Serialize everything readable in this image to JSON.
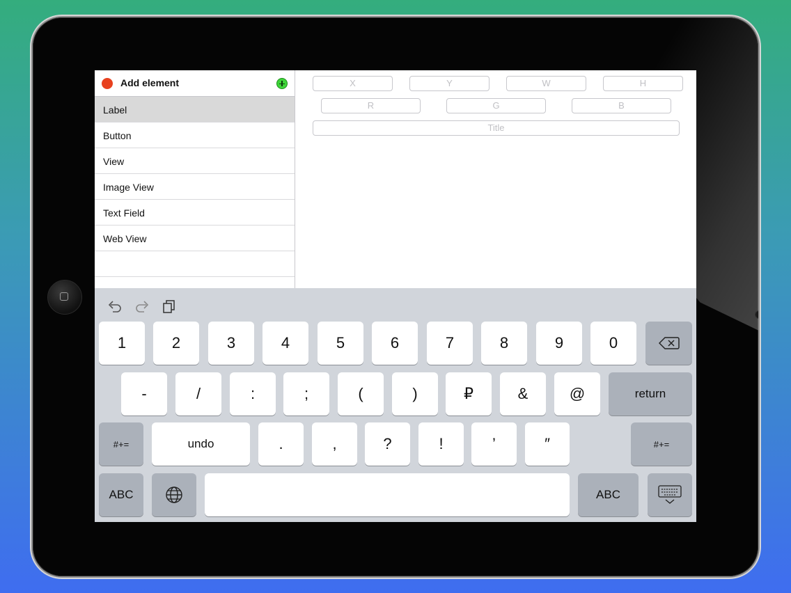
{
  "sidebar": {
    "title": "Add element",
    "items": [
      {
        "label": "Label"
      },
      {
        "label": "Button"
      },
      {
        "label": "View"
      },
      {
        "label": "Image View"
      },
      {
        "label": "Text Field"
      },
      {
        "label": "Web View"
      }
    ],
    "selected_index": 0
  },
  "inspector": {
    "placeholders": {
      "x": "X",
      "y": "Y",
      "w": "W",
      "h": "H",
      "r": "R",
      "g": "G",
      "b": "B",
      "title": "Title"
    }
  },
  "keyboard": {
    "row1": [
      "1",
      "2",
      "3",
      "4",
      "5",
      "6",
      "7",
      "8",
      "9",
      "0"
    ],
    "row2": [
      "-",
      "/",
      ":",
      ";",
      "(",
      ")",
      "₽",
      "&",
      "@"
    ],
    "return_label": "return",
    "row3_left": "#+=",
    "undo_label": "undo",
    "row3": [
      ".",
      ",",
      "?",
      "!",
      "’",
      "″"
    ],
    "row3_right": "#+=",
    "abc_left": "ABC",
    "abc_right": "ABC"
  },
  "colors": {
    "record_dot": "#e8411f",
    "add_button": "#3fd53a",
    "keyboard_bg": "#d1d5db",
    "selected_row": "#d9d9d9"
  },
  "icons": [
    "undo-icon",
    "redo-icon",
    "paste-icon",
    "delete-icon",
    "globe-icon",
    "keyboard-dismiss-icon",
    "home-button",
    "add-icon"
  ]
}
